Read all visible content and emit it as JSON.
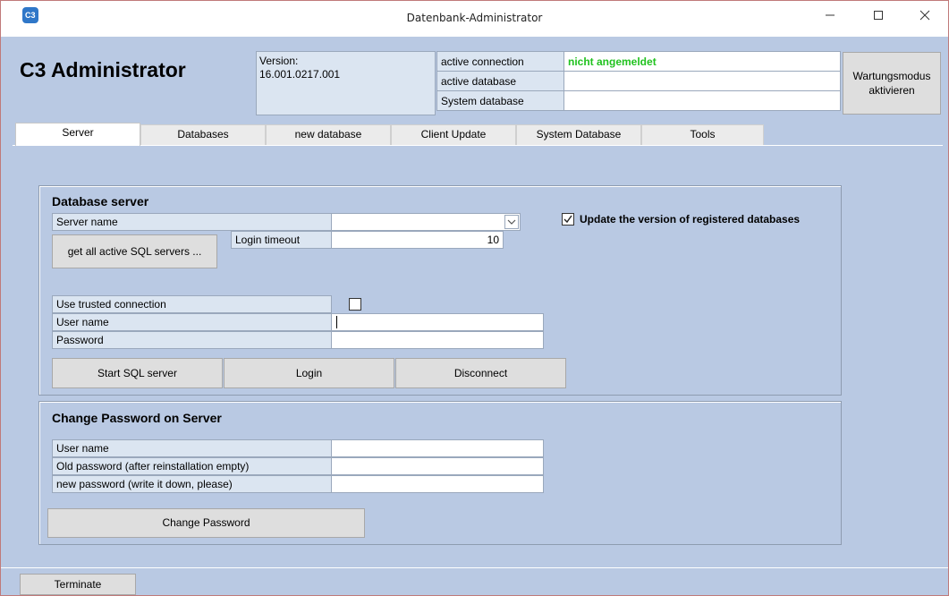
{
  "window": {
    "title": "Datenbank-Administrator",
    "controls": {
      "minimize": "—",
      "maximize": "☐",
      "close": "✕"
    }
  },
  "header": {
    "app_name": "C3 Administrator",
    "version_label": "Version:",
    "version_value": "16.001.0217.001",
    "rows": [
      {
        "label": "active connection",
        "value": "nicht angemeldet"
      },
      {
        "label": "active database",
        "value": ""
      },
      {
        "label": "System database",
        "value": ""
      }
    ],
    "maintenance_button": "Wartungsmodus aktivieren"
  },
  "tabs": [
    {
      "label": "Server",
      "active": true
    },
    {
      "label": "Databases",
      "active": false
    },
    {
      "label": "new database",
      "active": false
    },
    {
      "label": "Client Update",
      "active": false
    },
    {
      "label": "System Database",
      "active": false
    },
    {
      "label": "Tools",
      "active": false
    }
  ],
  "database_server": {
    "title": "Database server",
    "server_name_label": "Server name",
    "server_name_value": "",
    "get_servers_button": "get all active SQL servers ...",
    "login_timeout_label": "Login timeout",
    "login_timeout_value": "10",
    "update_version_label": "Update the version of registered databases",
    "update_version_checked": true,
    "trusted_connection_label": "Use trusted connection",
    "trusted_connection_checked": false,
    "user_name_label": "User name",
    "user_name_value": "",
    "password_label": "Password",
    "password_value": "",
    "start_button": "Start SQL server",
    "login_button": "Login",
    "disconnect_button": "Disconnect"
  },
  "change_password": {
    "title": "Change Password on Server",
    "user_name_label": "User name",
    "old_password_label": "Old password (after reinstallation empty)",
    "new_password_label": "new password (write it down, please)",
    "change_button": "Change Password"
  },
  "footer": {
    "terminate_button": "Terminate"
  },
  "colors": {
    "panel_bg": "#b9c9e3",
    "label_bg": "#dbe5f1",
    "status_green": "#21c21f"
  }
}
